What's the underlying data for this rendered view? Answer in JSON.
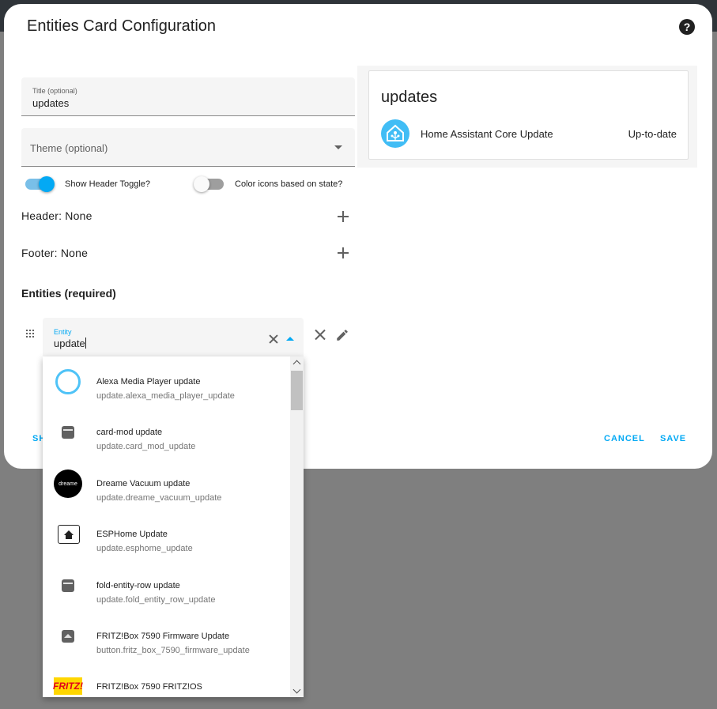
{
  "dialog": {
    "title": "Entities Card Configuration",
    "help_symbol": "?"
  },
  "form": {
    "title_label": "Title (optional)",
    "title_value": "updates",
    "theme_placeholder": "Theme (optional)",
    "show_header_toggle_label": "Show Header Toggle?",
    "show_header_toggle_on": true,
    "color_icons_label": "Color icons based on state?",
    "color_icons_on": false,
    "header_label": "Header: None",
    "footer_label": "Footer: None",
    "entities_title": "Entities (required)",
    "entity_label": "Entity",
    "entity_value": "update"
  },
  "actions": {
    "show_partial": "SH",
    "cancel": "CANCEL",
    "save": "SAVE"
  },
  "preview": {
    "title": "updates",
    "rows": [
      {
        "name": "Home Assistant Core Update",
        "state": "Up-to-date",
        "icon": "home-assistant-icon"
      }
    ]
  },
  "dropdown": {
    "items": [
      {
        "name": "Alexa Media Player update",
        "entity_id": "update.alexa_media_player_update",
        "icon": "alexa-icon"
      },
      {
        "name": "card-mod update",
        "entity_id": "update.card_mod_update",
        "icon": "package-icon"
      },
      {
        "name": "Dreame Vacuum update",
        "entity_id": "update.dreame_vacuum_update",
        "icon": "dreame-icon",
        "icon_text": "dreame"
      },
      {
        "name": "ESPHome Update",
        "entity_id": "update.esphome_update",
        "icon": "esphome-icon"
      },
      {
        "name": "fold-entity-row update",
        "entity_id": "update.fold_entity_row_update",
        "icon": "package-icon"
      },
      {
        "name": "FRITZ!Box 7590 Firmware Update",
        "entity_id": "button.fritz_box_7590_firmware_update",
        "icon": "package-up-icon"
      },
      {
        "name": "FRITZ!Box 7590 FRITZ!OS",
        "entity_id": "",
        "icon": "fritz-icon",
        "icon_text": "FRITZ!"
      }
    ]
  },
  "colors": {
    "accent": "#03a9f4",
    "overlay": "#7f7f7f",
    "ha_blue": "#41bdf5"
  }
}
